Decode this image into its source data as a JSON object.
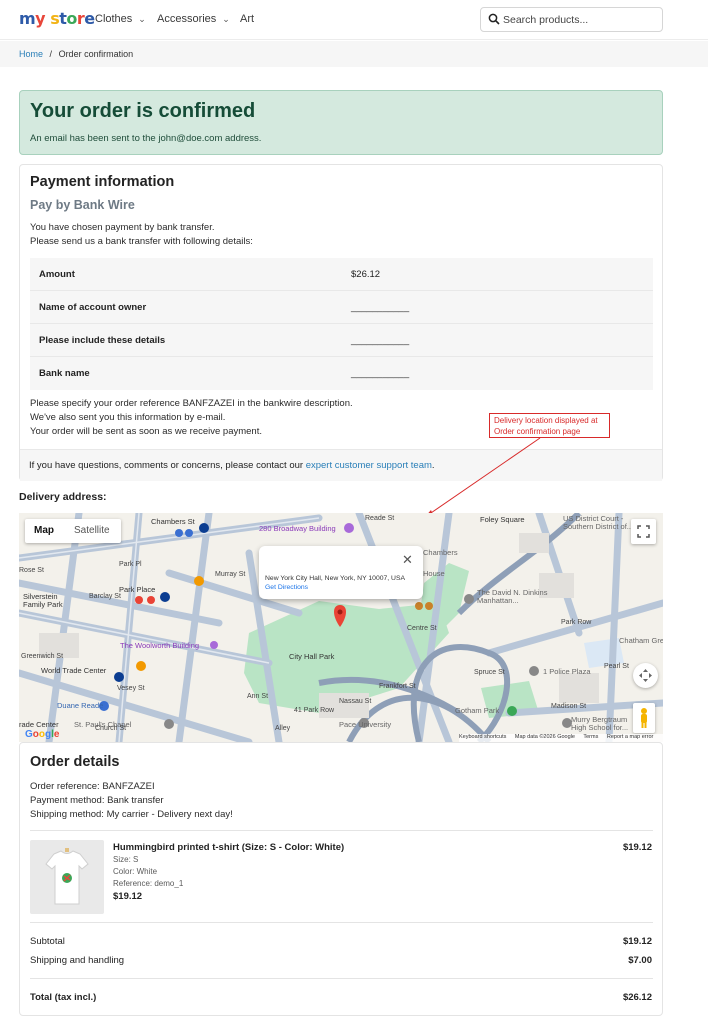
{
  "header": {
    "logo": {
      "text": "my store",
      "colors": [
        "#2e5aa8",
        "#e8463a",
        "#f2b316",
        "#2e5aa8",
        "#3aa757",
        "#e8463a",
        "#2e5aa8",
        "#f2b316"
      ]
    },
    "nav": [
      {
        "label": "Clothes",
        "has_dropdown": true
      },
      {
        "label": "Accessories",
        "has_dropdown": true
      },
      {
        "label": "Art",
        "has_dropdown": false
      }
    ],
    "search": {
      "placeholder": "Search products...",
      "icon": "search-icon"
    }
  },
  "breadcrumb": {
    "home": "Home",
    "separator": "/",
    "current": "Order confirmation"
  },
  "confirmation": {
    "title": "Your order is confirmed",
    "message": "An email has been sent to the john@doe.com address."
  },
  "payment": {
    "title": "Payment information",
    "method_title": "Pay by Bank Wire",
    "intro_1": "You have chosen payment by bank transfer.",
    "intro_2": "Please send us a bank transfer with following details:",
    "rows": [
      {
        "label": "Amount",
        "value": "$26.12"
      },
      {
        "label": "Name of account owner",
        "value": "___________"
      },
      {
        "label": "Please include these details",
        "value": "___________"
      },
      {
        "label": "Bank name",
        "value": "___________"
      }
    ],
    "note_1": "Please specify your order reference BANFZAZEI in the bankwire description.",
    "note_2": "We've also sent you this information by e-mail.",
    "note_3": "Your order will be sent as soon as we receive payment.",
    "support_prefix": "If you have questions, comments or concerns, please contact our ",
    "support_link": "expert customer support team",
    "support_suffix": "."
  },
  "annotation": {
    "line_1": "Delivery location displayed at",
    "line_2": "Order confirmation page"
  },
  "delivery": {
    "title": "Delivery address:",
    "map": {
      "toggle_map": "Map",
      "toggle_satellite": "Satellite",
      "info_address": "New York City Hall, New York, NY 10007, USA",
      "info_link": "Get Directions",
      "google": "Google",
      "footer": [
        "Keyboard shortcuts",
        "Map data ©2026 Google",
        "Terms",
        "Report a map error"
      ],
      "labels": [
        "Chambers St",
        "280 Broadway Building",
        "Reade St",
        "Foley Square",
        "US District Court - Southern District of...",
        "Park Pl",
        "Murray St",
        "Silverstein Family Park",
        "Park Place",
        "Barclay St",
        "Chambers",
        "House",
        "The David N. Dinkins Manhattan...",
        "Park Row",
        "Chatham Green",
        "The Woolworth Building",
        "City Hall Park",
        "Centre St",
        "World Trade Center",
        "Vesey St",
        "1 Police Plaza",
        "Duane Reade",
        "41 Park Row",
        "Nassau St",
        "Frankfort St",
        "Gotham Park",
        "St. Paul's Chapel",
        "Pace University",
        "Madison St",
        "Murry Bergtraum High School for...",
        "Greenwich St",
        "Church St",
        "Pearl St",
        "Rose St",
        "Ann St",
        "Spruce St",
        "Alley",
        "rade Center"
      ]
    }
  },
  "order": {
    "title": "Order details",
    "reference": "Order reference: BANFZAZEI",
    "payment_method": "Payment method: Bank transfer",
    "shipping_method": "Shipping method: My carrier - Delivery next day!",
    "item": {
      "name": "Hummingbird printed t-shirt (Size: S - Color: White)",
      "size": "Size: S",
      "color": "Color: White",
      "reference": "Reference: demo_1",
      "unit_price": "$19.12",
      "line_total": "$19.12"
    },
    "summary": [
      {
        "label": "Subtotal",
        "value": "$19.12"
      },
      {
        "label": "Shipping and handling",
        "value": "$7.00"
      }
    ],
    "total": {
      "label": "Total (tax incl.)",
      "value": "$26.12"
    }
  }
}
